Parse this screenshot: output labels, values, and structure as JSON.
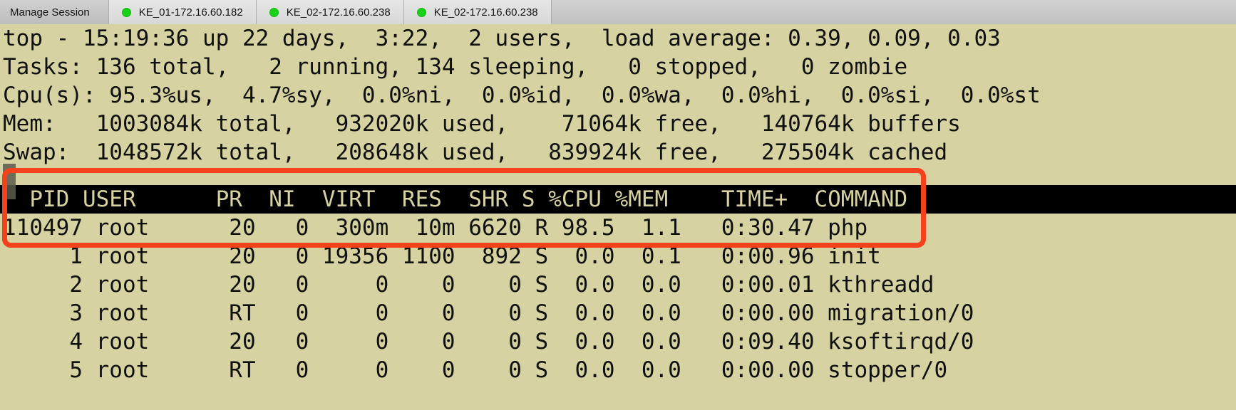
{
  "window": {
    "title": "top - 15:19:36"
  },
  "tabbar": {
    "manage_label": "Manage Session",
    "status_dot_color": "#19d119",
    "tabs": [
      {
        "label": "KE_01-172.16.60.182",
        "status": "connected"
      },
      {
        "label": "KE_02-172.16.60.238",
        "status": "connected"
      },
      {
        "label": "KE_02-172.16.60.238",
        "status": "connected"
      }
    ]
  },
  "terminal": {
    "background_color": "#d7d2a2",
    "foreground_color": "#101010",
    "header_bar_background": "#000000",
    "header_bar_foreground": "#d7d2a2",
    "summary_lines": [
      "top - 15:19:36 up 22 days,  3:22,  2 users,  load average: 0.39, 0.09, 0.03",
      "Tasks: 136 total,   2 running, 134 sleeping,   0 stopped,   0 zombie",
      "Cpu(s): 95.3%us,  4.7%sy,  0.0%ni,  0.0%id,  0.0%wa,  0.0%hi,  0.0%si,  0.0%st",
      "Mem:   1003084k total,   932020k used,    71064k free,   140764k buffers",
      "Swap:  1048572k total,   208648k used,   839924k free,   275504k cached"
    ],
    "summary": {
      "uptime_time": "15:19:36",
      "uptime_days": "22 days",
      "uptime_clock": "3:22",
      "users": "2 users",
      "load_average": [
        "0.39",
        "0.09",
        "0.03"
      ],
      "tasks": {
        "total": "136",
        "running": "2",
        "sleeping": "134",
        "stopped": "0",
        "zombie": "0"
      },
      "cpu": {
        "us": "95.3",
        "sy": "4.7",
        "ni": "0.0",
        "id": "0.0",
        "wa": "0.0",
        "hi": "0.0",
        "si": "0.0",
        "st": "0.0"
      },
      "mem": {
        "total": "1003084k",
        "used": "932020k",
        "free": "71064k",
        "buffers": "140764k"
      },
      "swap": {
        "total": "1048572k",
        "used": "208648k",
        "free": "839924k",
        "cached": "275504k"
      }
    },
    "column_header": "  PID USER      PR  NI  VIRT  RES  SHR S %CPU %MEM    TIME+  COMMAND",
    "columns": [
      "PID",
      "USER",
      "PR",
      "NI",
      "VIRT",
      "RES",
      "SHR",
      "S",
      "%CPU",
      "%MEM",
      "TIME+",
      "COMMAND"
    ],
    "process_lines": [
      "110497 root      20   0  300m  10m 6620 R 98.5  1.1   0:30.47 php",
      "     1 root      20   0 19356 1100  892 S  0.0  0.1   0:00.96 init",
      "     2 root      20   0     0    0    0 S  0.0  0.0   0:00.01 kthreadd",
      "     3 root      RT   0     0    0    0 S  0.0  0.0   0:00.00 migration/0",
      "     4 root      20   0     0    0    0 S  0.0  0.0   0:09.40 ksoftirqd/0",
      "     5 root      RT   0     0    0    0 S  0.0  0.0   0:00.00 stopper/0"
    ],
    "processes": [
      {
        "pid": "110497",
        "user": "root",
        "pr": "20",
        "ni": "0",
        "virt": "300m",
        "res": "10m",
        "shr": "6620",
        "s": "R",
        "cpu": "98.5",
        "mem": "1.1",
        "time": "0:30.47",
        "command": "php"
      },
      {
        "pid": "1",
        "user": "root",
        "pr": "20",
        "ni": "0",
        "virt": "19356",
        "res": "1100",
        "shr": "892",
        "s": "S",
        "cpu": "0.0",
        "mem": "0.1",
        "time": "0:00.96",
        "command": "init"
      },
      {
        "pid": "2",
        "user": "root",
        "pr": "20",
        "ni": "0",
        "virt": "0",
        "res": "0",
        "shr": "0",
        "s": "S",
        "cpu": "0.0",
        "mem": "0.0",
        "time": "0:00.01",
        "command": "kthreadd"
      },
      {
        "pid": "3",
        "user": "root",
        "pr": "RT",
        "ni": "0",
        "virt": "0",
        "res": "0",
        "shr": "0",
        "s": "S",
        "cpu": "0.0",
        "mem": "0.0",
        "time": "0:00.00",
        "command": "migration/0"
      },
      {
        "pid": "4",
        "user": "root",
        "pr": "20",
        "ni": "0",
        "virt": "0",
        "res": "0",
        "shr": "0",
        "s": "S",
        "cpu": "0.0",
        "mem": "0.0",
        "time": "0:09.40",
        "command": "ksoftirqd/0"
      },
      {
        "pid": "5",
        "user": "root",
        "pr": "RT",
        "ni": "0",
        "virt": "0",
        "res": "0",
        "shr": "0",
        "s": "S",
        "cpu": "0.0",
        "mem": "0.0",
        "time": "0:00.00",
        "command": "stopper/0"
      }
    ]
  },
  "annotation": {
    "color": "#f4431c",
    "shape": "rounded-rectangle",
    "target": "column-header-and-top-process-row"
  }
}
